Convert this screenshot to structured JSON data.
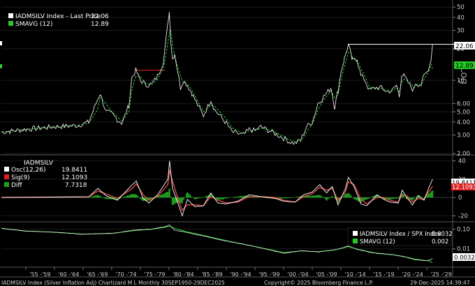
{
  "colors": {
    "background": "#000000",
    "price_line": "#ffffff",
    "smavg_line": "#2dc82d",
    "last_price_tag": "#ffffff",
    "sma_tag": "#22cc22",
    "osc_line": "#ffffff",
    "sig_line": "#e04848",
    "diff_bars": "#1ea01e",
    "sig_tag": "#e02020",
    "ratio_line": "#ffffff",
    "ratio_sma": "#22cc22",
    "breakout_line": "#cc2020"
  },
  "footer": {
    "left": "IADMSILV Index (Silver Inflation Adj) Chartizard M L Monthly 30SEP1950-29DEC2025",
    "center": "Copyright© 2025 Bloomberg Finance L.P.",
    "right": "29-Dec-2025 14:39:47"
  },
  "chart_data": [
    {
      "type": "line",
      "panel": "price",
      "scale": "log",
      "ylim": [
        2.0,
        55
      ],
      "y_ticks": [
        2.0,
        3.0,
        4.0,
        5.0,
        6.0,
        10,
        20,
        30,
        40,
        50
      ],
      "y_tick_labels": [
        "2.00",
        "3.00",
        "4.00",
        "5.00",
        "6.00",
        "10",
        "20",
        "30",
        "40",
        "50"
      ],
      "ylabel": "Log",
      "legend": [
        {
          "name": "IADMSILV Index - Last Price",
          "value": "22.06"
        },
        {
          "name": "SMAVG (12)",
          "value": "12.89"
        }
      ],
      "last_price_tag": "22.06",
      "sma_tag": "12.89",
      "resistance_level": 22.06,
      "breakout_level": 12.5,
      "series": [
        {
          "name": "IADMSILV Index - Last Price",
          "x": [
            1950.75,
            1955,
            1960,
            1964,
            1966,
            1967.5,
            1968,
            1969,
            1970,
            1971,
            1971.8,
            1973,
            1973.5,
            1974.2,
            1975,
            1976,
            1977,
            1978,
            1979,
            1979.5,
            1980.05,
            1980.3,
            1980.6,
            1981,
            1982,
            1982.5,
            1983.2,
            1984,
            1985,
            1986,
            1987.3,
            1988,
            1990,
            1991,
            1993,
            1994,
            1995,
            1996,
            1998,
            1999,
            2000,
            2001,
            2002,
            2003,
            2004,
            2005,
            2006,
            2007,
            2008.3,
            2008.9,
            2009.5,
            2010,
            2010.6,
            2011.3,
            2011.7,
            2012,
            2012.8,
            2013.5,
            2014,
            2015,
            2016,
            2017,
            2018,
            2019,
            2019.7,
            2020.2,
            2020.6,
            2021,
            2022,
            2022.7,
            2023,
            2023.5,
            2024,
            2024.5,
            2025,
            2025.5,
            2025.8,
            2025.99
          ],
          "y": [
            3.2,
            3.4,
            3.6,
            3.7,
            4.0,
            6.5,
            7.5,
            5.0,
            4.8,
            4.2,
            3.9,
            5.8,
            10.5,
            12.5,
            10.0,
            9.0,
            9.2,
            11.0,
            15.0,
            25.0,
            45.0,
            25.0,
            16.0,
            18.0,
            8.5,
            10.0,
            9.0,
            7.5,
            5.8,
            4.6,
            6.5,
            5.2,
            3.9,
            3.2,
            3.0,
            3.4,
            3.3,
            3.6,
            3.2,
            3.0,
            2.8,
            2.6,
            2.5,
            2.7,
            3.6,
            4.0,
            6.0,
            7.0,
            8.5,
            5.5,
            8.0,
            12.0,
            16.0,
            22.0,
            18.0,
            15.5,
            16.0,
            11.0,
            10.5,
            8.0,
            8.5,
            8.5,
            7.8,
            8.0,
            9.0,
            7.0,
            11.5,
            11.0,
            9.0,
            8.0,
            9.5,
            9.2,
            9.0,
            11.0,
            12.0,
            14.0,
            17.0,
            22.06
          ]
        },
        {
          "name": "SMAVG (12)",
          "x": [
            1950.75,
            1955,
            1960,
            1964,
            1966,
            1967.5,
            1968,
            1969,
            1970,
            1971,
            1971.8,
            1973,
            1973.5,
            1974.2,
            1975,
            1976,
            1977,
            1978,
            1979,
            1979.5,
            1980.05,
            1980.3,
            1980.6,
            1981,
            1982,
            1982.5,
            1983.2,
            1984,
            1985,
            1986,
            1987.3,
            1988,
            1990,
            1991,
            1993,
            1994,
            1995,
            1996,
            1998,
            1999,
            2000,
            2001,
            2002,
            2003,
            2004,
            2005,
            2006,
            2007,
            2008.3,
            2008.9,
            2009.5,
            2010,
            2010.6,
            2011.3,
            2011.7,
            2012,
            2012.8,
            2013.5,
            2014,
            2015,
            2016,
            2017,
            2018,
            2019,
            2019.7,
            2020.2,
            2020.6,
            2021,
            2022,
            2022.7,
            2023,
            2023.5,
            2024,
            2024.5,
            2025,
            2025.5,
            2025.8,
            2025.99
          ],
          "y": [
            3.2,
            3.4,
            3.6,
            3.7,
            3.9,
            5.2,
            6.8,
            6.0,
            5.0,
            4.5,
            4.0,
            5.0,
            8.0,
            11.0,
            10.8,
            9.3,
            9.1,
            10.2,
            13.0,
            18.0,
            28.0,
            30.0,
            22.0,
            17.0,
            11.0,
            9.5,
            9.3,
            8.0,
            6.3,
            5.0,
            5.8,
            5.6,
            4.3,
            3.5,
            3.1,
            3.3,
            3.3,
            3.5,
            3.3,
            3.1,
            2.9,
            2.7,
            2.6,
            2.6,
            3.2,
            3.8,
            5.2,
            6.5,
            7.9,
            6.8,
            7.2,
            10.0,
            13.5,
            18.5,
            18.5,
            16.5,
            15.8,
            12.8,
            11.5,
            8.6,
            8.3,
            8.4,
            8.0,
            7.9,
            8.5,
            7.8,
            9.5,
            10.3,
            9.7,
            8.5,
            8.8,
            9.2,
            9.1,
            10.2,
            11.3,
            12.6,
            14.2,
            12.89
          ]
        }
      ]
    },
    {
      "type": "line",
      "panel": "oscillator",
      "title": "IADMSILV",
      "ylim": [
        -25,
        45
      ],
      "y_ticks": [
        -20,
        0,
        20,
        40
      ],
      "y_tick_labels": [
        "-20",
        "0",
        "20",
        "40"
      ],
      "legend": [
        {
          "name": "Osc(12,26)",
          "value": "19.8411"
        },
        {
          "name": "Sig(9)",
          "value": "12.1093"
        },
        {
          "name": "Diff",
          "value": "7.7318"
        }
      ],
      "osc_tag": "19.8411",
      "sig_tag": "12.1093",
      "series": [
        {
          "name": "Osc(12,26)",
          "x": [
            1950.75,
            1960,
            1966,
            1967.6,
            1969,
            1971,
            1973.6,
            1974.3,
            1975.5,
            1976.5,
            1978,
            1979.8,
            1980.1,
            1980.6,
            1981.5,
            1982.3,
            1983.2,
            1984.5,
            1986,
            1987.3,
            1988.5,
            1990,
            1992,
            1994,
            1996,
            1998.5,
            2000,
            2002,
            2003.5,
            2005,
            2006.3,
            2007.5,
            2008.5,
            2009.5,
            2010.8,
            2011.3,
            2012.3,
            2013.5,
            2014.5,
            2016.3,
            2017.5,
            2018.5,
            2020,
            2020.7,
            2021.5,
            2022.5,
            2023.5,
            2024.5,
            2025.3,
            2025.99
          ],
          "y": [
            0,
            0.5,
            0.8,
            10,
            2,
            -3,
            14,
            18,
            -1,
            -6,
            3,
            20,
            40,
            10,
            -5,
            -20,
            -2,
            -10,
            -9,
            5,
            -6,
            -7,
            -4,
            3,
            1,
            -1,
            -4,
            -5,
            3,
            6,
            14,
            5,
            12,
            -8,
            10,
            22,
            12,
            -7,
            -9,
            3,
            -2,
            -5,
            -6,
            8,
            0,
            -8,
            2,
            -3,
            10,
            19.8411
          ]
        },
        {
          "name": "Sig(9)",
          "x": [
            1950.75,
            1960,
            1966,
            1967.6,
            1969,
            1971,
            1973.6,
            1974.3,
            1975.5,
            1976.5,
            1978,
            1979.8,
            1980.1,
            1980.6,
            1981.5,
            1982.3,
            1983.2,
            1984.5,
            1986,
            1987.3,
            1988.5,
            1990,
            1992,
            1994,
            1996,
            1998.5,
            2000,
            2002,
            2003.5,
            2005,
            2006.3,
            2007.5,
            2008.5,
            2009.5,
            2010.8,
            2011.3,
            2012.3,
            2013.5,
            2014.5,
            2016.3,
            2017.5,
            2018.5,
            2020,
            2020.7,
            2021.5,
            2022.5,
            2023.5,
            2024.5,
            2025.3,
            2025.99
          ],
          "y": [
            0,
            0.4,
            0.7,
            7,
            4,
            -1,
            10,
            15,
            3,
            -3,
            1,
            14,
            30,
            18,
            0,
            -14,
            -8,
            -8,
            -9,
            1,
            -3,
            -6,
            -5,
            1,
            1,
            0,
            -3,
            -5,
            1,
            4,
            11,
            8,
            10,
            -3,
            6,
            17,
            14,
            -2,
            -7,
            0,
            0,
            -3,
            -5,
            3,
            2,
            -5,
            -1,
            -2,
            6,
            12.1093
          ]
        },
        {
          "name": "Diff",
          "x": [
            1950.75,
            1960,
            1966,
            1967.6,
            1969,
            1971,
            1973.6,
            1974.3,
            1975.5,
            1976.5,
            1978,
            1979.8,
            1980.1,
            1980.6,
            1981.5,
            1982.3,
            1983.2,
            1984.5,
            1986,
            1987.3,
            1988.5,
            1990,
            1992,
            1994,
            1996,
            1998.5,
            2000,
            2002,
            2003.5,
            2005,
            2006.3,
            2007.5,
            2008.5,
            2009.5,
            2010.8,
            2011.3,
            2012.3,
            2013.5,
            2014.5,
            2016.3,
            2017.5,
            2018.5,
            2020,
            2020.7,
            2021.5,
            2022.5,
            2023.5,
            2024.5,
            2025.3,
            2025.99
          ],
          "y": [
            0,
            0.1,
            0.1,
            3,
            -2,
            -2,
            4,
            3,
            -4,
            -3,
            2,
            6,
            10,
            -8,
            -5,
            -6,
            6,
            -2,
            0,
            4,
            -3,
            -1,
            1,
            2,
            0,
            -1,
            -1,
            0,
            2,
            2,
            3,
            -3,
            2,
            -5,
            4,
            5,
            -2,
            -5,
            -2,
            3,
            -2,
            -2,
            -1,
            5,
            -2,
            -3,
            3,
            -1,
            4,
            7.7318
          ]
        }
      ]
    },
    {
      "type": "line",
      "panel": "ratio",
      "ylim": [
        0.0015,
        0.2
      ],
      "scale": "log",
      "y_ticks": [
        0.01,
        0.1
      ],
      "y_tick_labels": [
        "0.01",
        "0.10"
      ],
      "legend": [
        {
          "name": "IADMSILV Index / SPX Index",
          "value": "0.0032"
        },
        {
          "name": "SMAVG (12)",
          "value": "0.002"
        }
      ],
      "ratio_tag": "0.0032",
      "series": [
        {
          "name": "IADMSILV Index / SPX Index",
          "x": [
            1950.75,
            1955,
            1960,
            1965,
            1968,
            1970,
            1974,
            1977,
            1979,
            1980.1,
            1981,
            1983,
            1986,
            1990,
            1995,
            2000,
            2003,
            2006,
            2009,
            2011.3,
            2013,
            2016,
            2019,
            2021,
            2023,
            2024.5,
            2025.3,
            2025.99
          ],
          "y": [
            0.11,
            0.08,
            0.07,
            0.055,
            0.06,
            0.06,
            0.09,
            0.1,
            0.13,
            0.16,
            0.09,
            0.07,
            0.045,
            0.025,
            0.013,
            0.006,
            0.008,
            0.007,
            0.009,
            0.014,
            0.009,
            0.006,
            0.005,
            0.004,
            0.0028,
            0.0025,
            0.0026,
            0.0032
          ]
        },
        {
          "name": "SMAVG (12)",
          "x": [
            1950.75,
            1955,
            1960,
            1965,
            1968,
            1970,
            1974,
            1977,
            1979,
            1980.1,
            1981,
            1983,
            1986,
            1990,
            1995,
            2000,
            2003,
            2006,
            2009,
            2011.3,
            2013,
            2016,
            2019,
            2021,
            2023,
            2024.5,
            2025.3,
            2025.99
          ],
          "y": [
            0.11,
            0.08,
            0.07,
            0.056,
            0.059,
            0.06,
            0.085,
            0.1,
            0.12,
            0.14,
            0.11,
            0.075,
            0.048,
            0.026,
            0.013,
            0.0065,
            0.0078,
            0.0072,
            0.0088,
            0.013,
            0.0095,
            0.0062,
            0.0051,
            0.0041,
            0.003,
            0.0026,
            0.0025,
            0.002
          ]
        }
      ]
    }
  ],
  "x_axis": {
    "tick_labels": [
      "'55 -'59",
      "'60 -'64",
      "'65 -'69",
      "'70 -'74",
      "'75 -'79",
      "'80 -'84",
      "'85 -'89",
      "'90 -'94",
      "'95 -'99",
      "'00 -'04",
      "'05 -'09",
      "'10 -'14",
      "'15 -'19",
      "'20 -'24",
      "'25 -'29"
    ],
    "range": [
      1950.75,
      2029.5
    ]
  }
}
